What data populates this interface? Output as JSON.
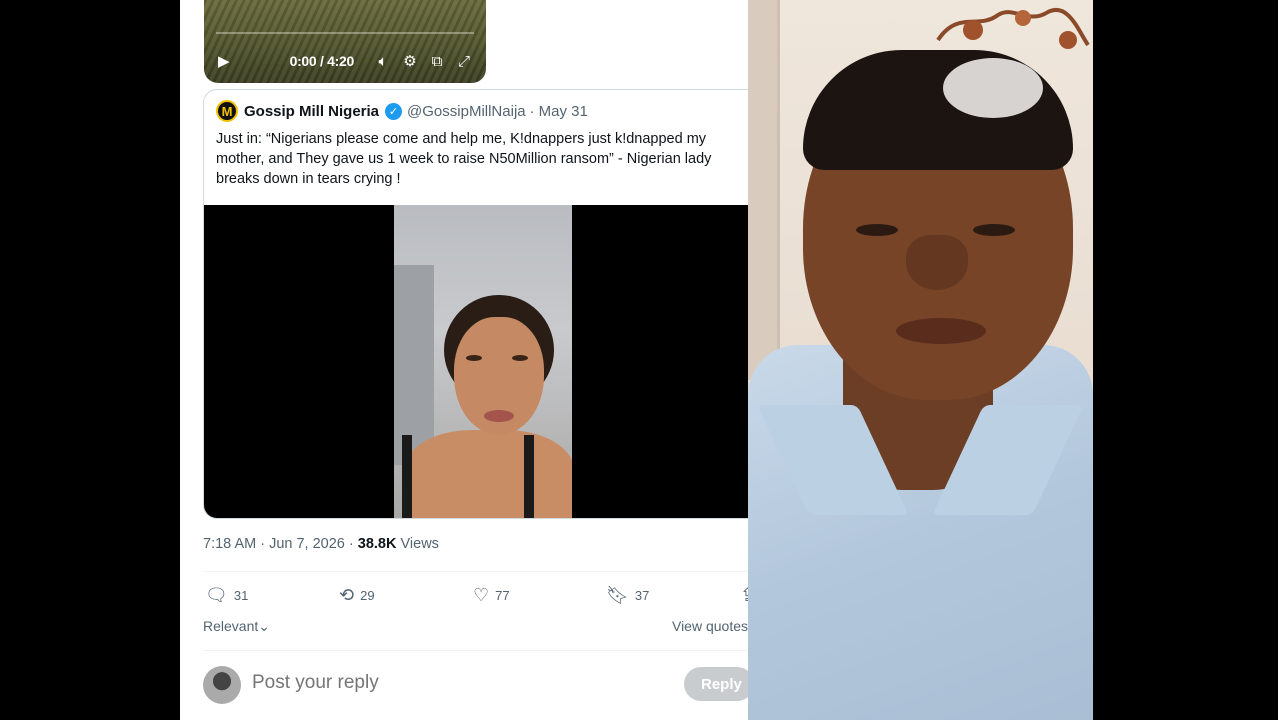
{
  "top_video": {
    "time": "0:00 / 4:20"
  },
  "quote": {
    "avatar_letter": "M",
    "name": "Gossip Mill Nigeria",
    "handle": "@GossipMillNaija",
    "date": "May 31",
    "text": "Just in: “Nigerians please come and help me, K!dnappers just k!dnapped my mother, and They gave us 1 week to raise N50Million ransom” - Nigerian lady breaks down in tears crying !"
  },
  "post_meta": {
    "time_date": "7:18 AM · Jun 7, 2026 · ",
    "views_count": "38.8K",
    "views_label": " Views"
  },
  "actions": {
    "replies": "31",
    "reposts": "29",
    "likes": "77",
    "bookmarks": "37"
  },
  "sort_label": "Relevant",
  "view_quotes": "View quotes",
  "reply": {
    "placeholder": "Post your reply",
    "button": "Reply"
  },
  "icons": [
    "play-icon",
    "volume-icon",
    "settings-icon",
    "pip-icon",
    "fullscreen-icon",
    "verified-icon",
    "reply-icon",
    "repost-icon",
    "like-icon",
    "bookmark-icon",
    "share-icon",
    "chevron-down-icon"
  ],
  "colors": {
    "accent": "#1d9bf0",
    "muted_text": "#536471",
    "text": "#0f1419"
  }
}
